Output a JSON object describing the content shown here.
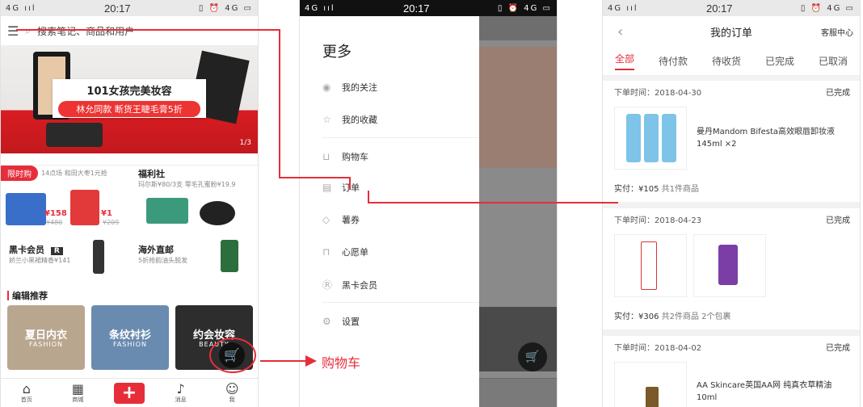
{
  "status": {
    "time": "20:17",
    "net": "4G"
  },
  "home": {
    "search_placeholder": "搜索笔记、商品和用户",
    "banner_title": "101女孩完美妆容",
    "banner_sub": "林允同款 断货王睫毛膏5折",
    "banner_index": "1/3",
    "flash": {
      "tag": "限时购",
      "sub": "14点场 和田大枣1元抢",
      "p1": "¥158",
      "p1_old": "¥480",
      "p2": "¥1",
      "p2_old": "¥209"
    },
    "welfare": {
      "title": "福利社",
      "sub": "玛尔斯¥80/3支 零毛孔蜜粉¥19.9"
    },
    "vip": {
      "title": "黑卡会员",
      "sub": "娇兰小黑裙精香¥141",
      "badge": "R"
    },
    "overseas": {
      "title": "海外直邮",
      "sub": "5折抢韵油头脱发"
    },
    "editor_title": "编辑推荐",
    "tiles": [
      {
        "a": "夏日内衣",
        "b": "FASHION",
        "color": "#b9a68f"
      },
      {
        "a": "条纹衬衫",
        "b": "FASHION",
        "color": "#6a8bb0"
      },
      {
        "a": "约会妆容",
        "b": "BEAUTY",
        "color": "#2d2d2d"
      }
    ],
    "nav": [
      "首页",
      "商城",
      "",
      "消息",
      "我"
    ]
  },
  "drawer": {
    "title": "更多",
    "items": [
      "我的关注",
      "我的收藏",
      "购物车",
      "订单",
      "薯券",
      "心愿单",
      "黑卡会员",
      "设置"
    ],
    "annotation": "购物车"
  },
  "orders": {
    "title": "我的订单",
    "service": "客服中心",
    "tabs": [
      "全部",
      "待付款",
      "待收货",
      "已完成",
      "已取消"
    ],
    "list": [
      {
        "time": "下单时间：2018-04-30",
        "status": "已完成",
        "desc": "曼丹Mandom Bifesta高效眼唇卸妆液 145ml ×2",
        "paid": "实付：¥105",
        "count": "共1件商品"
      },
      {
        "time": "下单时间：2018-04-23",
        "status": "已完成",
        "desc": "",
        "paid": "实付：¥306",
        "count": "共2件商品 2个包裹"
      },
      {
        "time": "下单时间：2018-04-02",
        "status": "已完成",
        "desc": "AA Skincare英国AA网 纯真衣草精油 10ml",
        "paid": "",
        "count": ""
      }
    ]
  }
}
